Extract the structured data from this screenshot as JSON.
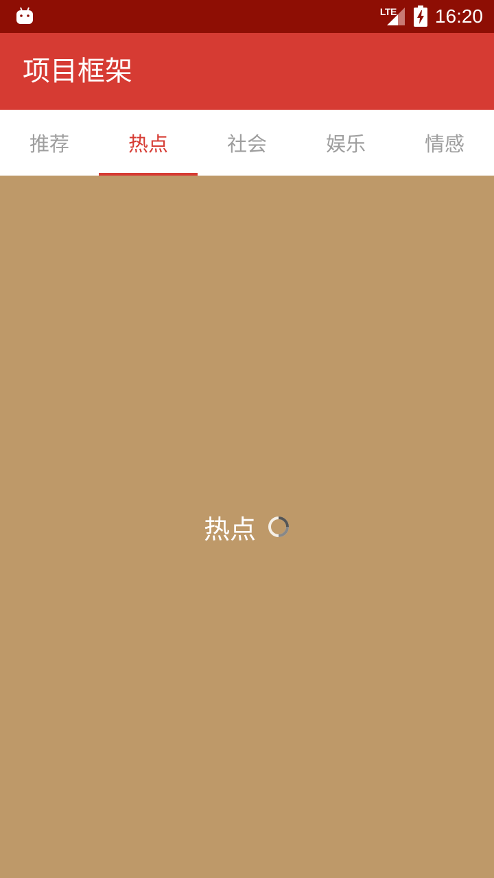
{
  "status_bar": {
    "network": "LTE",
    "time": "16:20",
    "icons": [
      "android-debug-icon",
      "signal-icon",
      "battery-charging-icon"
    ]
  },
  "app_bar": {
    "title": "项目框架"
  },
  "tabs": [
    {
      "label": "推荐"
    },
    {
      "label": "热点"
    },
    {
      "label": "社会"
    },
    {
      "label": "娱乐"
    },
    {
      "label": "情感"
    }
  ],
  "active_tab": 1,
  "content": {
    "loading_text": "热点",
    "background": "#be9969"
  },
  "colors": {
    "status_bar": "#8e0e04",
    "accent": "#d63b33",
    "tab_inactive": "#9e9e9e"
  }
}
